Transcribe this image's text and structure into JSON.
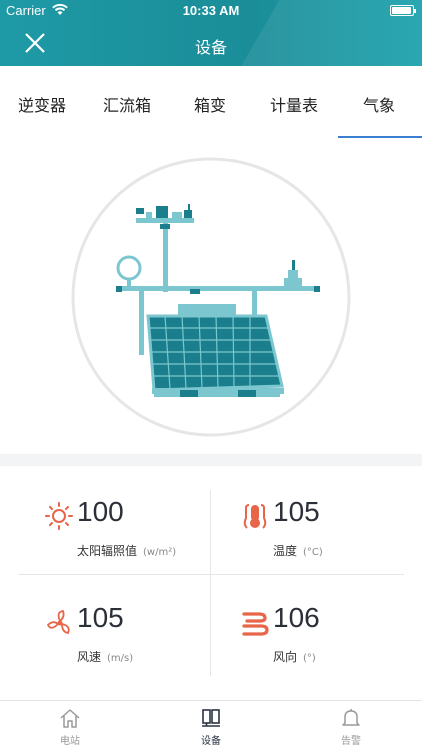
{
  "status_bar": {
    "carrier": "Carrier",
    "time": "10:33 AM"
  },
  "header": {
    "title": "设备"
  },
  "tabs": [
    {
      "label": "逆变器",
      "active": false
    },
    {
      "label": "汇流箱",
      "active": false
    },
    {
      "label": "箱变",
      "active": false
    },
    {
      "label": "计量表",
      "active": false
    },
    {
      "label": "气象",
      "active": true
    }
  ],
  "metrics": [
    {
      "value": "100",
      "label": "太阳辐照值",
      "unit": "(w/m²)",
      "icon": "sun-icon",
      "color": "#e8654a"
    },
    {
      "value": "105",
      "label": "温度",
      "unit": "(°C)",
      "icon": "thermometer-icon",
      "color": "#e8654a"
    },
    {
      "value": "105",
      "label": "风速",
      "unit": "(m/s)",
      "icon": "fan-icon",
      "color": "#e8654a"
    },
    {
      "value": "106",
      "label": "风向",
      "unit": "(°)",
      "icon": "wind-icon",
      "color": "#e8654a"
    }
  ],
  "tabbar": [
    {
      "label": "电站",
      "icon": "home-icon",
      "active": false
    },
    {
      "label": "设备",
      "icon": "device-icon",
      "active": true
    },
    {
      "label": "告警",
      "icon": "bell-icon",
      "active": false
    }
  ],
  "colors": {
    "accent": "#1e9aa6",
    "tab_underline": "#3a7fd0",
    "panel": "#1a7e8c",
    "warning": "#e8654a"
  }
}
